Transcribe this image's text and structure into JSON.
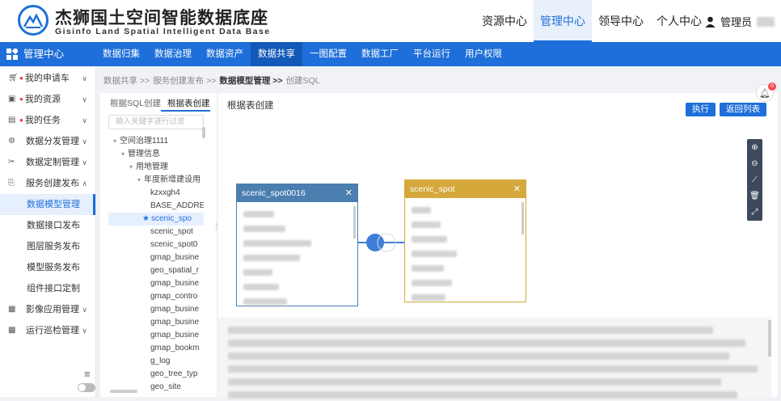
{
  "header": {
    "logo_title": "杰狮国土空间智能数据底座",
    "logo_subtitle": "Gisinfo Land Spatial Intelligent Data Base",
    "nav": [
      "资源中心",
      "管理中心",
      "领导中心",
      "个人中心"
    ],
    "active_nav": "管理中心",
    "user_label": "管理员"
  },
  "subbar": {
    "title": "管理中心",
    "items": [
      "数据归集",
      "数据治理",
      "数据资产",
      "数据共享",
      "一图配置",
      "数据工厂",
      "平台运行",
      "用户权限"
    ],
    "active": "数据共享"
  },
  "sidebar": {
    "items": [
      {
        "icon": "cart-icon",
        "label": "我的申请车",
        "dot": true
      },
      {
        "icon": "resource-icon",
        "label": "我的资源",
        "dot": true
      },
      {
        "icon": "task-icon",
        "label": "我的任务",
        "dot": true
      },
      {
        "icon": "distribute-icon",
        "label": "数据分发管理"
      },
      {
        "icon": "custom-icon",
        "label": "数据定制管理"
      },
      {
        "icon": "publish-icon",
        "label": "服务创建发布",
        "expanded": true
      }
    ],
    "sub_items": [
      "数据模型管理",
      "数据接口发布",
      "图层服务发布",
      "模型服务发布",
      "组件接口定制"
    ],
    "active_sub": "数据模型管理",
    "bottom_items": [
      {
        "icon": "image-icon",
        "label": "影像应用管理"
      },
      {
        "icon": "ops-icon",
        "label": "运行巡检管理"
      }
    ]
  },
  "breadcrumb": [
    "数据共享 >>",
    "服务创建发布 >>",
    "数据模型管理 >>",
    "创建SQL"
  ],
  "left_panel": {
    "tabs": [
      "根据SQL创建",
      "根据表创建"
    ],
    "active_tab": "根据表创建",
    "search_placeholder": "输入关键字进行过滤",
    "tree": [
      {
        "label": "空间治理1111",
        "level": 0,
        "arrow": "▾"
      },
      {
        "label": "管理信息",
        "level": 1,
        "arrow": "▾"
      },
      {
        "label": "用地管理",
        "level": 2,
        "arrow": "▾"
      },
      {
        "label": "年度新增建设用",
        "level": 3,
        "arrow": "▾"
      },
      {
        "label": "kzxxgh4",
        "level": 4
      },
      {
        "label": "BASE_ADDRE",
        "level": 4
      },
      {
        "label": "scenic_spo",
        "level": 4,
        "selected": true
      },
      {
        "label": "scenic_spot",
        "level": 4
      },
      {
        "label": "scenic_spot0",
        "level": 4
      },
      {
        "label": "gmap_busine",
        "level": 4
      },
      {
        "label": "geo_spatial_r",
        "level": 4
      },
      {
        "label": "gmap_busine",
        "level": 4
      },
      {
        "label": "gmap_contro",
        "level": 4
      },
      {
        "label": "gmap_busine",
        "level": 4
      },
      {
        "label": "gmap_busine",
        "level": 4
      },
      {
        "label": "gmap_busine",
        "level": 4
      },
      {
        "label": "gmap_bookm",
        "level": 4
      },
      {
        "label": "g_log",
        "level": 4
      },
      {
        "label": "geo_tree_typ",
        "level": 4
      },
      {
        "label": "geo_site",
        "level": 4
      }
    ]
  },
  "canvas": {
    "title": "根据表创建",
    "run_label": "执行",
    "back_label": "返回列表",
    "tables": [
      {
        "name": "scenic_spot0016",
        "color": "#4a7fb0",
        "close": "✕"
      },
      {
        "name": "scenic_spot",
        "color": "#d4a83a",
        "close": "✕"
      }
    ],
    "bell_count": "0"
  },
  "tools": [
    "zoom-in-icon",
    "zoom-out-icon",
    "line-icon",
    "delete-icon",
    "fullscreen-icon"
  ]
}
